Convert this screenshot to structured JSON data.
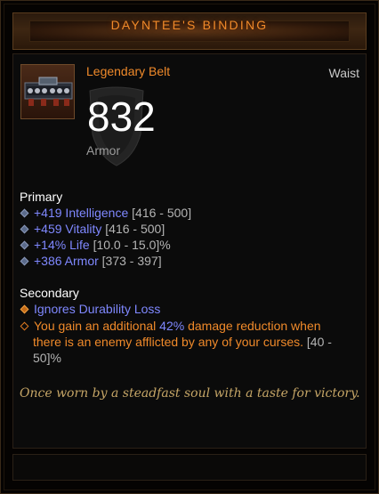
{
  "item": {
    "name": "DAYNTEE'S BINDING",
    "type": "Legendary Belt",
    "slot": "Waist",
    "armor_value": "832",
    "armor_label": "Armor",
    "icon": "belt-icon"
  },
  "primary": {
    "title": "Primary",
    "stats": [
      {
        "value": "+419 Intelligence",
        "range": "[416 - 500]"
      },
      {
        "value": "+459 Vitality",
        "range": "[416 - 500]"
      },
      {
        "value": "+14% Life",
        "range": "[10.0 - 15.0]%"
      },
      {
        "value": "+386 Armor",
        "range": "[373 - 397]"
      }
    ]
  },
  "secondary": {
    "title": "Secondary",
    "stat1": "Ignores Durability Loss",
    "legendary_line1_a": "You gain an additional ",
    "legendary_line1_b": "42%",
    "legendary_line1_c": " damage reduction when",
    "legendary_line2_a": "there is an enemy afflicted by any of your curses.",
    "legendary_line2_b": " [40 -",
    "legendary_line3": "50]%"
  },
  "flavor_text": "Once worn by a steadfast soul with a taste for victory.",
  "colors": {
    "legendary": "#f08a2a",
    "magic": "#7f88ff",
    "range": "#b4b4b4",
    "flavor": "#c5a566"
  }
}
